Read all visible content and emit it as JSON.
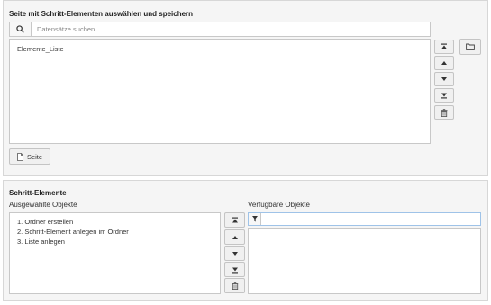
{
  "page_section": {
    "title": "Seite mit Schritt-Elementen auswählen und speichern",
    "search_placeholder": "Datensätze suchen",
    "items": [
      "Elemente_Liste"
    ],
    "page_button_label": "Seite"
  },
  "steps_section": {
    "title": "Schritt-Elemente",
    "selected_label": "Ausgewählte Objekte",
    "available_label": "Verfügbare Objekte",
    "selected_items": [
      "1. Ordner erstellen",
      "2. Schritt-Element anlegen im Ordner",
      "3. Liste anlegen"
    ],
    "available_items": [],
    "filter_value": ""
  },
  "icons": {
    "search": "search-icon",
    "folder": "folder-icon",
    "move_top": "move-top-icon",
    "move_up": "move-up-icon",
    "move_down": "move-down-icon",
    "move_bottom": "move-bottom-icon",
    "delete": "trash-icon",
    "filter": "filter-icon",
    "page": "page-icon"
  }
}
